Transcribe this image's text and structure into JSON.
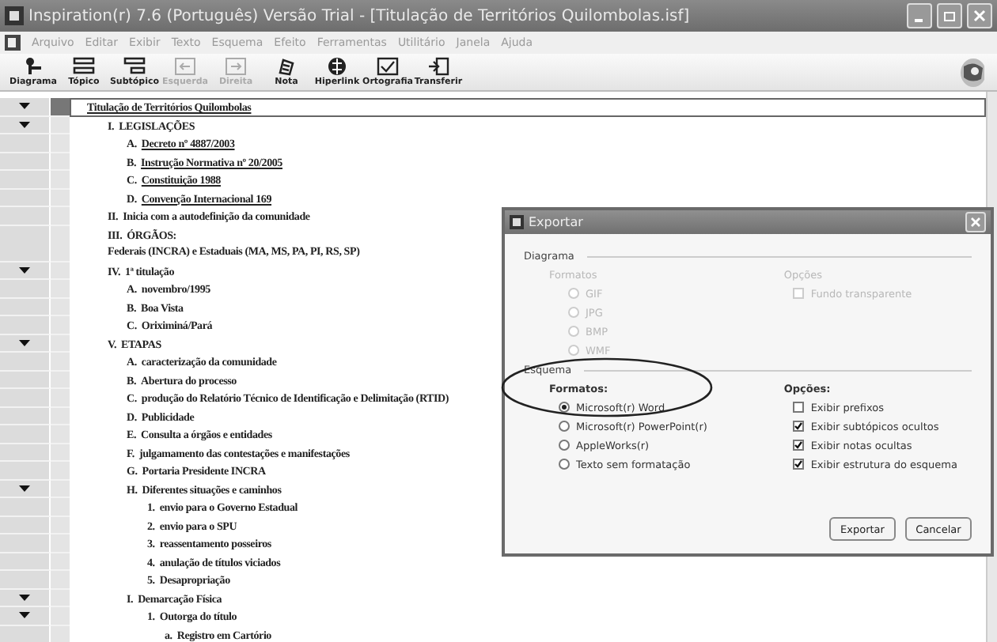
{
  "window": {
    "title": "Inspiration(r) 7.6 (Português) Versão Trial - [Titulação de Territórios Quilombolas.isf]"
  },
  "menu": [
    "Arquivo",
    "Editar",
    "Exibir",
    "Texto",
    "Esquema",
    "Efeito",
    "Ferramentas",
    "Utilitário",
    "Janela",
    "Ajuda"
  ],
  "toolbar": [
    {
      "kind": "diagram",
      "label": "Diagrama",
      "disabled": false
    },
    {
      "kind": "topic",
      "label": "Tópico",
      "disabled": false
    },
    {
      "kind": "subtopic",
      "label": "Subtópico",
      "disabled": false
    },
    {
      "kind": "left",
      "label": "Esquerda",
      "disabled": true
    },
    {
      "kind": "right",
      "label": "Direita",
      "disabled": true
    },
    {
      "kind": "note",
      "label": "Nota",
      "disabled": false
    },
    {
      "kind": "hyperlink",
      "label": "Hiperlink",
      "disabled": false
    },
    {
      "kind": "spelling",
      "label": "Ortografia",
      "disabled": false
    },
    {
      "kind": "transfer",
      "label": "Transferir",
      "disabled": false
    }
  ],
  "outline": {
    "title": "Titulação de Territórios Quilombolas",
    "expanded": true,
    "children": [
      {
        "prefix": "I.",
        "text": "LEGISLAÇÕES",
        "link": false,
        "expanded": true,
        "children": [
          {
            "prefix": "A.",
            "text": "Decreto nº 4887/2003",
            "link": true,
            "expanded": false
          },
          {
            "prefix": "B.",
            "text": "Instrução Normativa nº 20/2005",
            "link": true,
            "expanded": false
          },
          {
            "prefix": "C.",
            "text": "Constituição 1988",
            "link": true,
            "expanded": false
          },
          {
            "prefix": "D.",
            "text": "Convenção Internacional 169",
            "link": true,
            "expanded": false
          }
        ]
      },
      {
        "prefix": "II.",
        "text": "Inicia com a autodefinição da comunidade",
        "link": false,
        "expanded": false
      },
      {
        "prefix": "III.",
        "text": "ÓRGÃOS:",
        "detail": "Federais (INCRA) e Estaduais (MA, MS, PA, PI, RS, SP)",
        "link": false,
        "expanded": false
      },
      {
        "prefix": "IV.",
        "text": "1ª titulação",
        "link": false,
        "expanded": true,
        "children": [
          {
            "prefix": "A.",
            "text": "novembro/1995",
            "link": false,
            "expanded": false
          },
          {
            "prefix": "B.",
            "text": "Boa Vista",
            "link": false,
            "expanded": false
          },
          {
            "prefix": "C.",
            "text": "Oriximiná/Pará",
            "link": false,
            "expanded": false
          }
        ]
      },
      {
        "prefix": "V.",
        "text": "ETAPAS",
        "link": false,
        "expanded": true,
        "children": [
          {
            "prefix": "A.",
            "text": "caracterização da comunidade",
            "link": false,
            "expanded": false
          },
          {
            "prefix": "B.",
            "text": "Abertura do processo",
            "link": false,
            "expanded": false
          },
          {
            "prefix": "C.",
            "text": "produção do Relatório Técnico de Identificação e Delimitação (RTID)",
            "link": false,
            "expanded": false
          },
          {
            "prefix": "D.",
            "text": "Publicidade",
            "link": false,
            "expanded": false
          },
          {
            "prefix": "E.",
            "text": "Consulta a órgãos e entidades",
            "link": false,
            "expanded": false
          },
          {
            "prefix": "F.",
            "text": "julgamamento das contestações e manifestações",
            "link": false,
            "expanded": false
          },
          {
            "prefix": "G.",
            "text": "Portaria Presidente INCRA",
            "link": false,
            "expanded": false
          },
          {
            "prefix": "H.",
            "text": "Diferentes situações e caminhos",
            "link": false,
            "expanded": true,
            "children": [
              {
                "prefix": "1.",
                "text": "envio para o Governo Estadual",
                "link": false,
                "expanded": false
              },
              {
                "prefix": "2.",
                "text": "envio para o SPU",
                "link": false,
                "expanded": false
              },
              {
                "prefix": "3.",
                "text": "reassentamento posseiros",
                "link": false,
                "expanded": false
              },
              {
                "prefix": "4.",
                "text": "anulação de títulos viciados",
                "link": false,
                "expanded": false
              },
              {
                "prefix": "5.",
                "text": "Desapropriação",
                "link": false,
                "expanded": false
              }
            ]
          },
          {
            "prefix": "I.",
            "text": "Demarcação Física",
            "link": false,
            "expanded": true,
            "children": [
              {
                "prefix": "1.",
                "text": "Outorga do título",
                "link": false,
                "expanded": true,
                "children": [
                  {
                    "prefix": "a.",
                    "text": "Registro em Cartório",
                    "link": false,
                    "expanded": false
                  }
                ]
              }
            ]
          }
        ]
      }
    ]
  },
  "dialog": {
    "title": "Exportar",
    "sections": [
      {
        "heading": "Diagrama",
        "disabled": true,
        "formats_label": "Formatos",
        "formats": [
          {
            "label": "GIF",
            "selected": false
          },
          {
            "label": "JPG",
            "selected": false
          },
          {
            "label": "BMP",
            "selected": false
          },
          {
            "label": "WMF",
            "selected": false
          }
        ],
        "options_label": "Opções",
        "options": [
          {
            "label": "Fundo transparente",
            "checked": false
          }
        ]
      },
      {
        "heading": "Esquema",
        "disabled": false,
        "formats_label": "Formatos:",
        "formats": [
          {
            "label": "Microsoft(r) Word",
            "selected": true
          },
          {
            "label": "Microsoft(r) PowerPoint(r)",
            "selected": false
          },
          {
            "label": "AppleWorks(r)",
            "selected": false
          },
          {
            "label": "Texto sem formatação",
            "selected": false
          }
        ],
        "options_label": "Opções:",
        "options": [
          {
            "label": "Exibir prefixos",
            "checked": false
          },
          {
            "label": "Exibir subtópicos ocultos",
            "checked": true
          },
          {
            "label": "Exibir notas ocultas",
            "checked": true
          },
          {
            "label": "Exibir estrutura do esquema",
            "checked": true
          }
        ]
      }
    ],
    "buttons": [
      "Exportar",
      "Cancelar"
    ]
  }
}
